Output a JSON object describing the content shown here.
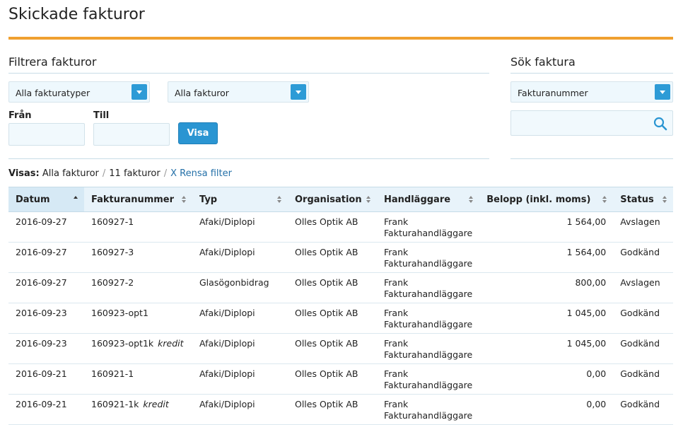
{
  "page": {
    "title": "Skickade fakturor",
    "accent_color": "#f0a030"
  },
  "filter": {
    "title": "Filtrera fakturor",
    "type_select": "Alla fakturatyper",
    "status_select": "Alla fakturor",
    "from_label": "Från",
    "to_label": "Till",
    "from_value": "",
    "to_value": "",
    "show_button": "Visa"
  },
  "search": {
    "title": "Sök faktura",
    "field_select": "Fakturanummer",
    "query": ""
  },
  "summary": {
    "prefix": "Visas:",
    "scope": "Alla fakturor",
    "count": "11 fakturor",
    "clear": "X Rensa filter"
  },
  "table": {
    "columns": [
      "Datum",
      "Fakturanummer",
      "Typ",
      "Organisation",
      "Handläggare",
      "Belopp (inkl. moms)",
      "Status"
    ],
    "rows": [
      {
        "date": "2016-09-27",
        "number": "160927-1",
        "kredit": "",
        "type": "Afaki/Diplopi",
        "org": "Olles Optik AB",
        "handler_first": "Frank",
        "handler_last": "Fakturahandläggare",
        "amount": "1 564,00",
        "status": "Avslagen"
      },
      {
        "date": "2016-09-27",
        "number": "160927-3",
        "kredit": "",
        "type": "Afaki/Diplopi",
        "org": "Olles Optik AB",
        "handler_first": "Frank",
        "handler_last": "Fakturahandläggare",
        "amount": "1 564,00",
        "status": "Godkänd"
      },
      {
        "date": "2016-09-27",
        "number": "160927-2",
        "kredit": "",
        "type": "Glasögonbidrag",
        "org": "Olles Optik AB",
        "handler_first": "Frank",
        "handler_last": "Fakturahandläggare",
        "amount": "800,00",
        "status": "Avslagen"
      },
      {
        "date": "2016-09-23",
        "number": "160923-opt1",
        "kredit": "",
        "type": "Afaki/Diplopi",
        "org": "Olles Optik AB",
        "handler_first": "Frank",
        "handler_last": "Fakturahandläggare",
        "amount": "1 045,00",
        "status": "Godkänd"
      },
      {
        "date": "2016-09-23",
        "number": "160923-opt1k",
        "kredit": "kredit",
        "type": "Afaki/Diplopi",
        "org": "Olles Optik AB",
        "handler_first": "Frank",
        "handler_last": "Fakturahandläggare",
        "amount": "1 045,00",
        "status": "Godkänd"
      },
      {
        "date": "2016-09-21",
        "number": "160921-1",
        "kredit": "",
        "type": "Afaki/Diplopi",
        "org": "Olles Optik AB",
        "handler_first": "Frank",
        "handler_last": "Fakturahandläggare",
        "amount": "0,00",
        "status": "Godkänd"
      },
      {
        "date": "2016-09-21",
        "number": "160921-1k",
        "kredit": "kredit",
        "type": "Afaki/Diplopi",
        "org": "Olles Optik AB",
        "handler_first": "Frank",
        "handler_last": "Fakturahandläggare",
        "amount": "0,00",
        "status": "Godkänd"
      }
    ]
  }
}
